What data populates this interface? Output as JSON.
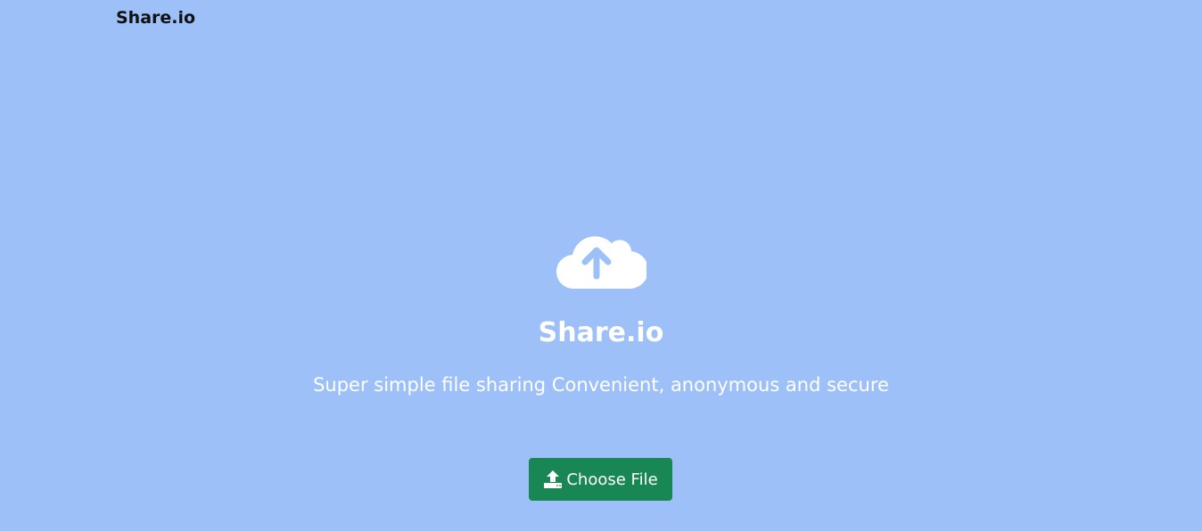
{
  "navbar": {
    "brand": "Share.io"
  },
  "hero": {
    "icon": "cloud-upload-icon",
    "title": "Share.io",
    "subtitle": "Super simple file sharing Convenient, anonymous and secure"
  },
  "upload": {
    "icon": "upload-icon",
    "label": "Choose File"
  },
  "colors": {
    "background": "#9dc0f8",
    "button": "#198754",
    "brand_text": "#111111",
    "hero_text": "#ffffff"
  }
}
